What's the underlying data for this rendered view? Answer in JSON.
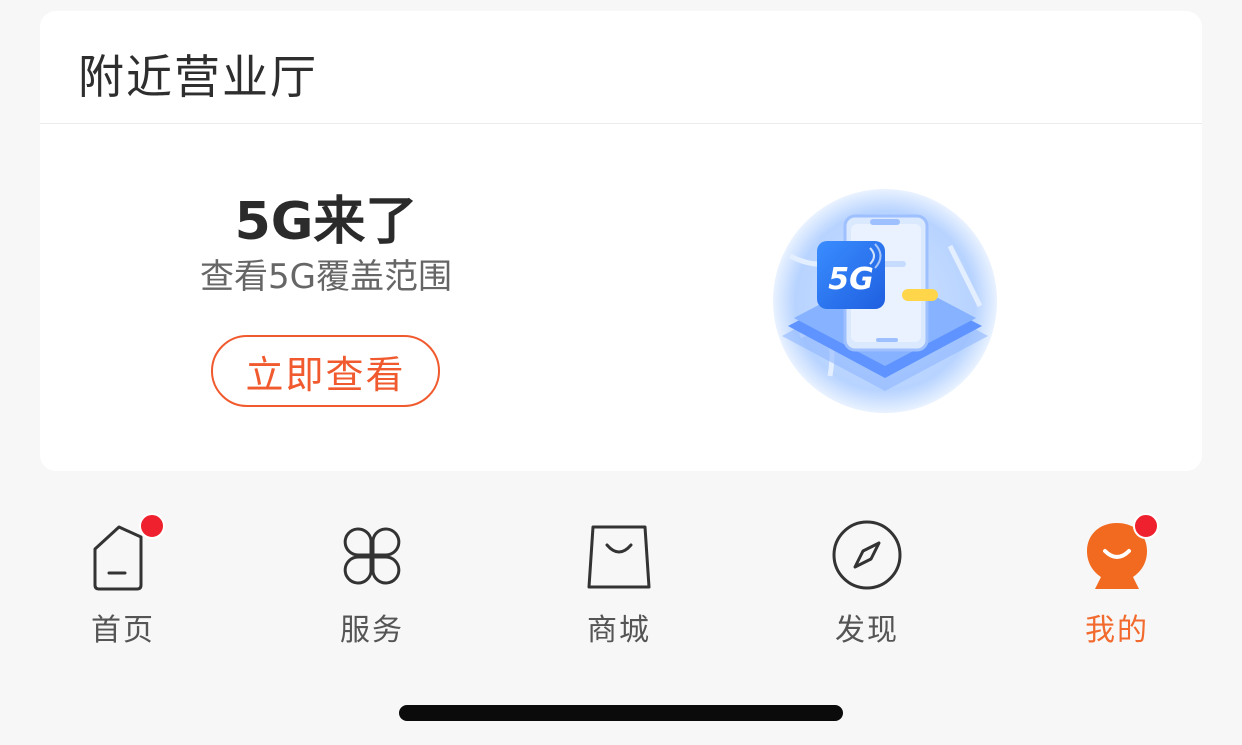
{
  "card": {
    "title": "附近营业厅",
    "promo": {
      "title": "5G来了",
      "subtitle": "查看5G覆盖范围",
      "button_label": "立即查看",
      "badge_text": "5G"
    }
  },
  "tabbar": {
    "items": [
      {
        "label": "首页",
        "icon": "home-icon",
        "has_badge": true
      },
      {
        "label": "服务",
        "icon": "grid-icon",
        "has_badge": false
      },
      {
        "label": "商城",
        "icon": "shopping-bag-icon",
        "has_badge": false
      },
      {
        "label": "发现",
        "icon": "compass-icon",
        "has_badge": false
      },
      {
        "label": "我的",
        "icon": "profile-avatar-icon",
        "has_badge": true,
        "active": true
      }
    ]
  },
  "colors": {
    "accent": "#f05a2e",
    "badge": "#f0212e",
    "active_tab": "#f26a2e"
  }
}
